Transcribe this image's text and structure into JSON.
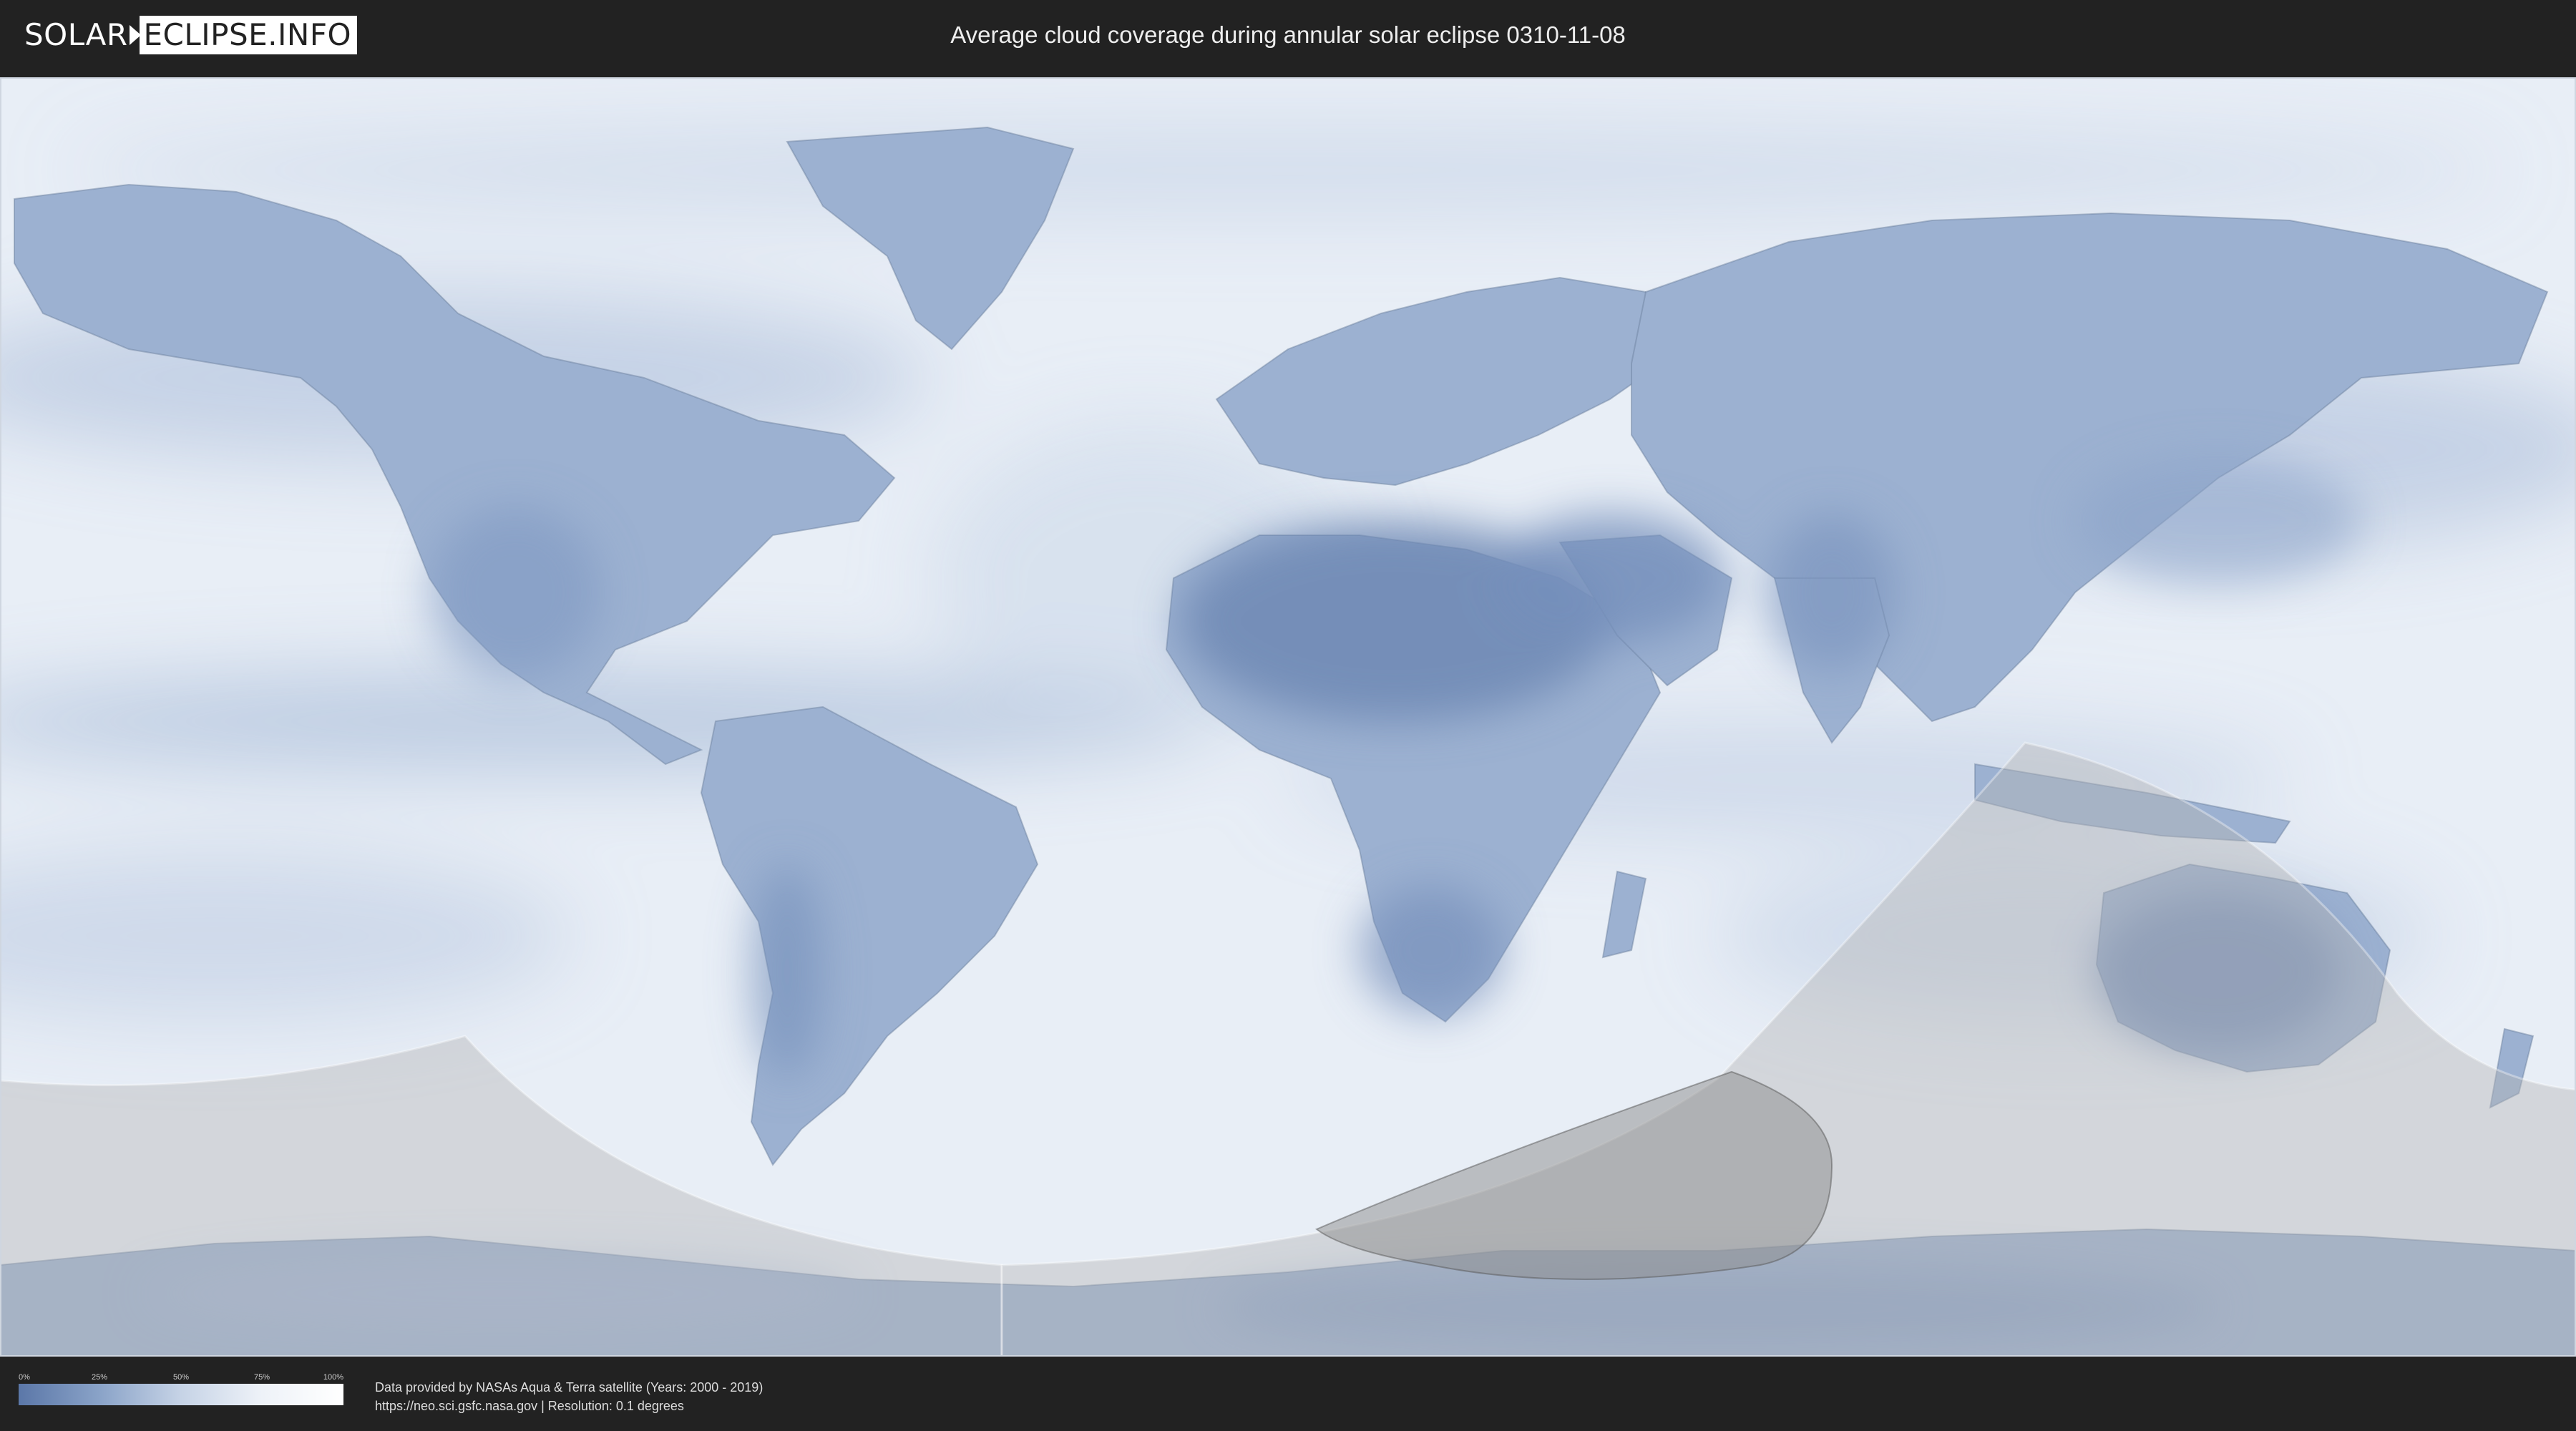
{
  "header": {
    "logo_part1": "SOLAR",
    "logo_part2": "ECLIPSE.INFO",
    "title": "Average cloud coverage during annular solar eclipse 0310-11-08"
  },
  "legend": {
    "labels": [
      "0%",
      "25%",
      "50%",
      "75%",
      "100%"
    ],
    "gradient_colors": [
      "#5b77a8",
      "#8aa3c8",
      "#c6d3e6",
      "#eef2f8",
      "#ffffff"
    ]
  },
  "credits": {
    "line1": "Data provided by NASAs Aqua & Terra satellite (Years: 2000 - 2019)",
    "line2": "https://neo.sci.gsfc.nasa.gov | Resolution: 0.1 degrees"
  },
  "colors": {
    "background": "#222222",
    "ocean_cloud": "#e9eff7",
    "land_clear": "#6f88b4",
    "eclipse_shadow": "#b4b4b4",
    "central_path": "#8c8c8c"
  }
}
